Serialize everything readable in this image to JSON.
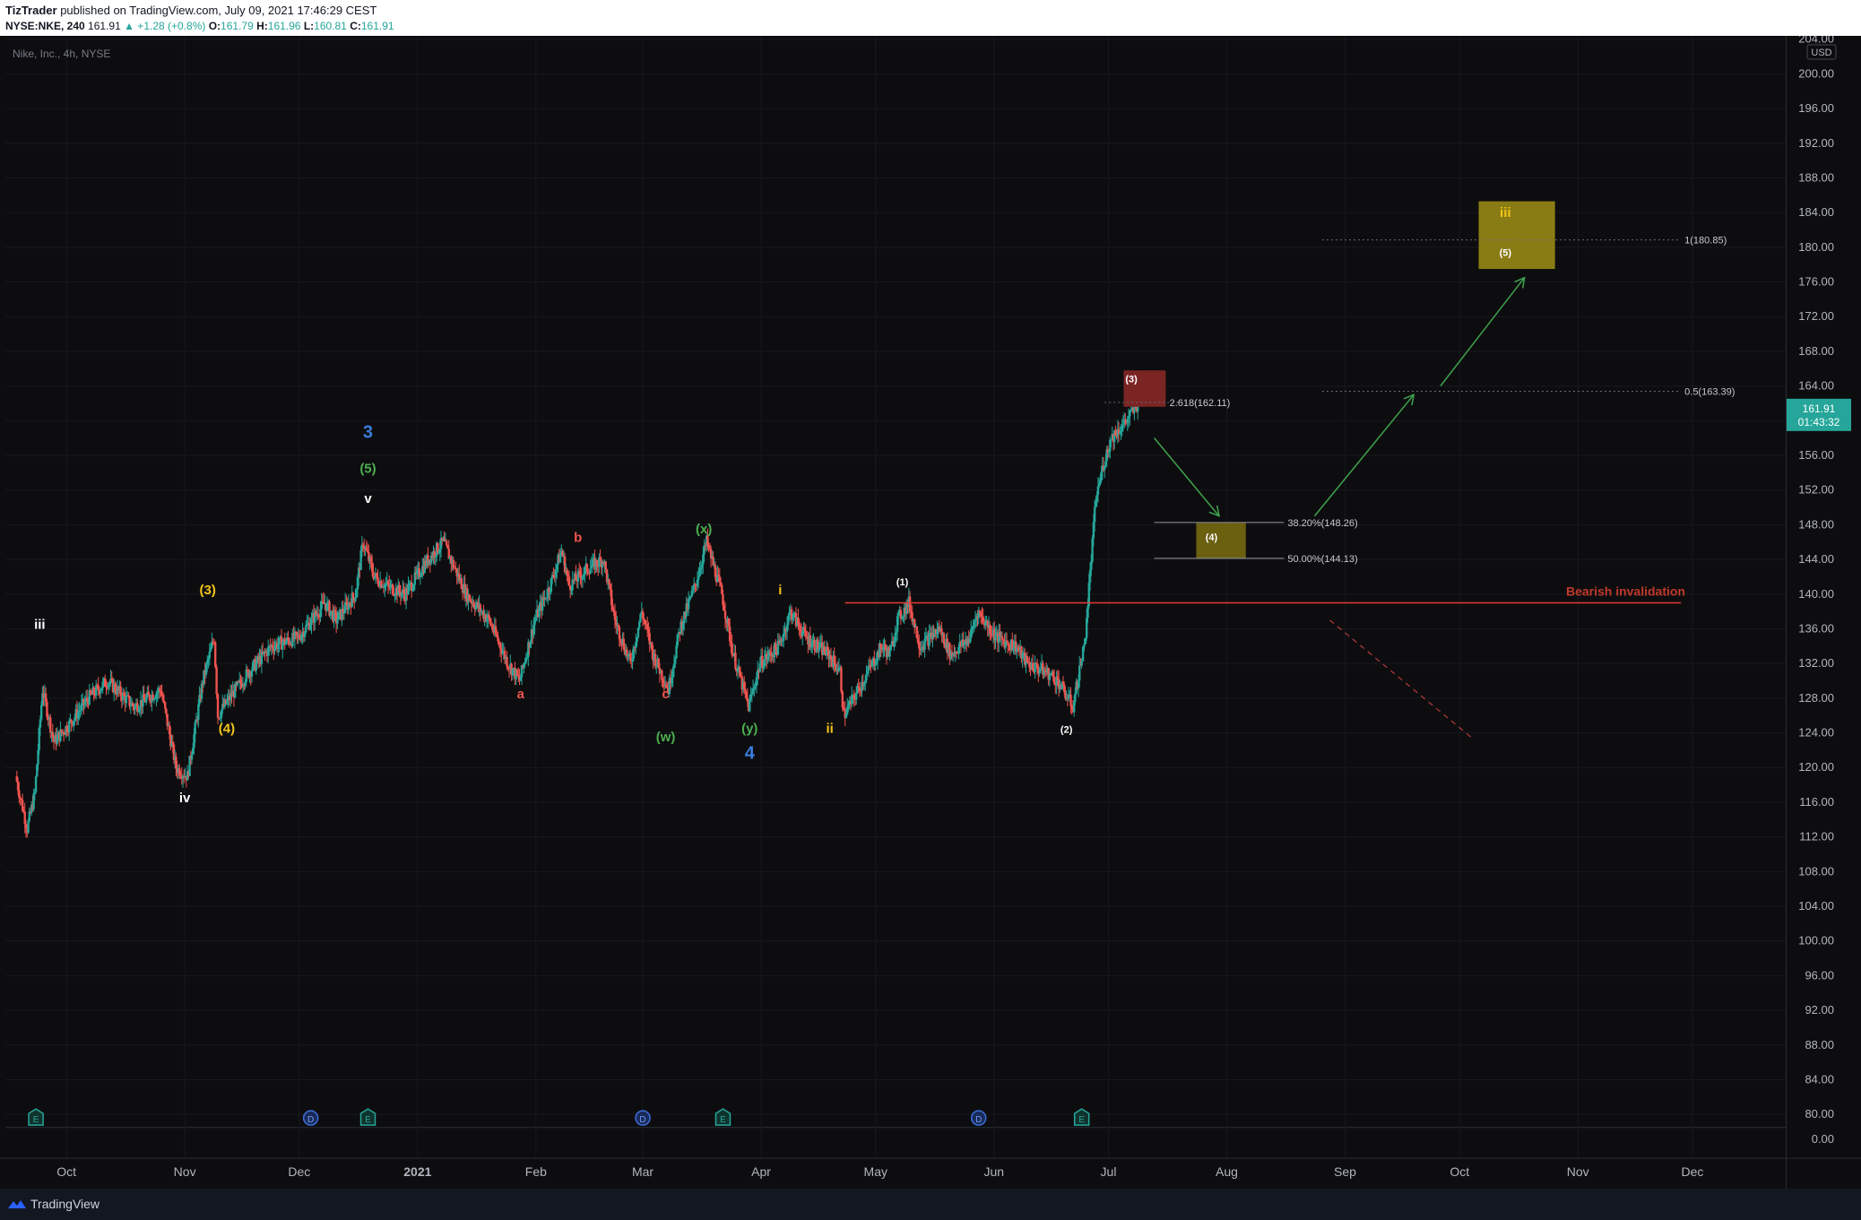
{
  "header": {
    "author": "TizTrader",
    "published_text": "published on TradingView.com, July 09, 2021 17:46:29 CEST",
    "symbol": "NYSE:NKE, 240",
    "last": "161.91",
    "change": "▲ +1.28 (+0.8%)",
    "o_label": "O:",
    "o": "161.79",
    "h_label": "H:",
    "h": "161.96",
    "l_label": "L:",
    "l": "160.81",
    "c_label": "C:",
    "c": "161.91"
  },
  "chart": {
    "legend_title": "Nike, Inc., 4h, NYSE",
    "currency": "USD",
    "price_label": "161.91",
    "countdown": "01:43:32",
    "ohlc_count_note": "",
    "annotation_invalidation": "Bearish invalidation",
    "colors": {
      "up": "#26a69a",
      "down": "#ef5350",
      "bg": "#0d0d0f",
      "grid": "#1c1e24"
    }
  },
  "chart_data": {
    "type": "candlestick",
    "title": "Nike, Inc., 4h, NYSE",
    "ylim": [
      78,
      205
    ],
    "y_ticks": [
      "0.00",
      "80.00",
      "84.00",
      "88.00",
      "92.00",
      "96.00",
      "100.00",
      "104.00",
      "108.00",
      "112.00",
      "116.00",
      "120.00",
      "124.00",
      "128.00",
      "132.00",
      "136.00",
      "140.00",
      "144.00",
      "148.00",
      "152.00",
      "156.00",
      "160.00",
      "164.00",
      "168.00",
      "172.00",
      "176.00",
      "180.00",
      "184.00",
      "188.00",
      "192.00",
      "196.00",
      "200.00",
      "204.00"
    ],
    "x_ticks": [
      "Oct",
      "Nov",
      "Dec",
      "2021",
      "Feb",
      "Mar",
      "Apr",
      "May",
      "Jun",
      "Jul",
      "Aug",
      "Sep",
      "Oct",
      "Nov",
      "Dec"
    ],
    "price_path": [
      [
        "2020-09-18",
        119
      ],
      [
        "2020-09-21",
        113
      ],
      [
        "2020-09-23",
        117
      ],
      [
        "2020-09-25",
        129
      ],
      [
        "2020-09-28",
        123
      ],
      [
        "2020-10-02",
        125
      ],
      [
        "2020-10-07",
        128
      ],
      [
        "2020-10-12",
        130
      ],
      [
        "2020-10-19",
        127
      ],
      [
        "2020-10-26",
        129
      ],
      [
        "2020-10-30",
        120
      ],
      [
        "2020-11-02",
        119
      ],
      [
        "2020-11-06",
        130
      ],
      [
        "2020-11-09",
        135
      ],
      [
        "2020-11-10",
        126
      ],
      [
        "2020-11-13",
        128
      ],
      [
        "2020-11-18",
        131
      ],
      [
        "2020-11-24",
        134
      ],
      [
        "2020-12-01",
        135
      ],
      [
        "2020-12-08",
        139
      ],
      [
        "2020-12-11",
        137
      ],
      [
        "2020-12-16",
        140
      ],
      [
        "2020-12-18",
        146
      ],
      [
        "2020-12-21",
        142
      ],
      [
        "2020-12-24",
        141
      ],
      [
        "2020-12-29",
        140
      ],
      [
        "2021-01-04",
        144
      ],
      [
        "2021-01-08",
        146
      ],
      [
        "2021-01-11",
        143
      ],
      [
        "2021-01-14",
        140
      ],
      [
        "2021-01-20",
        137
      ],
      [
        "2021-01-25",
        132
      ],
      [
        "2021-01-28",
        130
      ],
      [
        "2021-02-01",
        137
      ],
      [
        "2021-02-05",
        141
      ],
      [
        "2021-02-08",
        145
      ],
      [
        "2021-02-10",
        141
      ],
      [
        "2021-02-15",
        143
      ],
      [
        "2021-02-19",
        144
      ],
      [
        "2021-02-22",
        137
      ],
      [
        "2021-02-26",
        132
      ],
      [
        "2021-03-01",
        138
      ],
      [
        "2021-03-04",
        133
      ],
      [
        "2021-03-08",
        129
      ],
      [
        "2021-03-11",
        136
      ],
      [
        "2021-03-15",
        141
      ],
      [
        "2021-03-18",
        146
      ],
      [
        "2021-03-22",
        140
      ],
      [
        "2021-03-25",
        133
      ],
      [
        "2021-03-29",
        127
      ],
      [
        "2021-04-01",
        132
      ],
      [
        "2021-04-06",
        134
      ],
      [
        "2021-04-09",
        138
      ],
      [
        "2021-04-13",
        135
      ],
      [
        "2021-04-19",
        133
      ],
      [
        "2021-04-22",
        131
      ],
      [
        "2021-04-23",
        126
      ],
      [
        "2021-04-28",
        130
      ],
      [
        "2021-05-03",
        134
      ],
      [
        "2021-05-05",
        133
      ],
      [
        "2021-05-07",
        137
      ],
      [
        "2021-05-10",
        139
      ],
      [
        "2021-05-13",
        134
      ],
      [
        "2021-05-18",
        136
      ],
      [
        "2021-05-21",
        133
      ],
      [
        "2021-05-26",
        135
      ],
      [
        "2021-05-28",
        138
      ],
      [
        "2021-06-02",
        135
      ],
      [
        "2021-06-07",
        134
      ],
      [
        "2021-06-10",
        132
      ],
      [
        "2021-06-15",
        131
      ],
      [
        "2021-06-18",
        130
      ],
      [
        "2021-06-22",
        127
      ],
      [
        "2021-06-24",
        132
      ],
      [
        "2021-06-25",
        134
      ],
      [
        "2021-06-28",
        151
      ],
      [
        "2021-06-30",
        155
      ],
      [
        "2021-07-02",
        158
      ],
      [
        "2021-07-06",
        160
      ],
      [
        "2021-07-09",
        161.91
      ]
    ],
    "wave_labels": [
      {
        "text": "iii",
        "date": "2020-09-24",
        "price": 136,
        "color": "#ffffff"
      },
      {
        "text": "iv",
        "date": "2020-11-01",
        "price": 116,
        "color": "#ffffff"
      },
      {
        "text": "(3)",
        "date": "2020-11-07",
        "price": 140,
        "color": "#f5c518"
      },
      {
        "text": "(4)",
        "date": "2020-11-12",
        "price": 124,
        "color": "#f5c518"
      },
      {
        "text": "3",
        "date": "2020-12-19",
        "price": 158,
        "color": "#3b7ddd"
      },
      {
        "text": "(5)",
        "date": "2020-12-19",
        "price": 154,
        "color": "#4caf50"
      },
      {
        "text": "v",
        "date": "2020-12-19",
        "price": 150.5,
        "color": "#ffffff"
      },
      {
        "text": "a",
        "date": "2021-01-28",
        "price": 128,
        "color": "#ef5350"
      },
      {
        "text": "b",
        "date": "2021-02-12",
        "price": 146,
        "color": "#ef5350"
      },
      {
        "text": "c",
        "date": "2021-03-07",
        "price": 128,
        "color": "#ef5350"
      },
      {
        "text": "(w)",
        "date": "2021-03-07",
        "price": 123,
        "color": "#4caf50"
      },
      {
        "text": "(x)",
        "date": "2021-03-17",
        "price": 147,
        "color": "#4caf50"
      },
      {
        "text": "(y)",
        "date": "2021-03-29",
        "price": 124,
        "color": "#4caf50"
      },
      {
        "text": "4",
        "date": "2021-03-29",
        "price": 121,
        "color": "#3b7ddd"
      },
      {
        "text": "i",
        "date": "2021-04-06",
        "price": 140,
        "color": "#f5c518"
      },
      {
        "text": "ii",
        "date": "2021-04-19",
        "price": 124,
        "color": "#f5c518"
      },
      {
        "text": "(1)",
        "date": "2021-05-08",
        "price": 141,
        "color": "#ffffff"
      },
      {
        "text": "(2)",
        "date": "2021-06-20",
        "price": 124,
        "color": "#ffffff"
      },
      {
        "text": "(3)",
        "date": "2021-07-07",
        "price": 164.4,
        "color": "#ffffff"
      },
      {
        "text": "(4)",
        "date": "2021-07-28",
        "price": 146.2,
        "color": "#ffffff"
      },
      {
        "text": "iii",
        "date": "2021-10-13",
        "price": 183.5,
        "color": "#f5c518"
      },
      {
        "text": "(5)",
        "date": "2021-10-13",
        "price": 179,
        "color": "#ffffff"
      }
    ],
    "levels": [
      {
        "text": "2.618(162.11)",
        "price": 162.11,
        "from": "2021-06-30",
        "to": "2021-07-27"
      },
      {
        "text": "38.20%(148.26)",
        "price": 148.26,
        "from": "2021-07-13",
        "to": "2021-08-16"
      },
      {
        "text": "50.00%(144.13)",
        "price": 144.13,
        "from": "2021-07-13",
        "to": "2021-08-16"
      },
      {
        "text": "0.5(163.39)",
        "price": 163.39,
        "from": "2021-08-26",
        "to": "2021-11-28"
      },
      {
        "text": "1(180.85)",
        "price": 180.85,
        "from": "2021-08-26",
        "to": "2021-11-28"
      }
    ],
    "invalidation_level": 139,
    "event_markers": [
      {
        "type": "E",
        "date": "2020-09-23"
      },
      {
        "type": "D",
        "date": "2020-12-04"
      },
      {
        "type": "E",
        "date": "2020-12-19"
      },
      {
        "type": "D",
        "date": "2021-03-01"
      },
      {
        "type": "E",
        "date": "2021-03-22"
      },
      {
        "type": "D",
        "date": "2021-05-28"
      },
      {
        "type": "E",
        "date": "2021-06-24"
      }
    ]
  }
}
